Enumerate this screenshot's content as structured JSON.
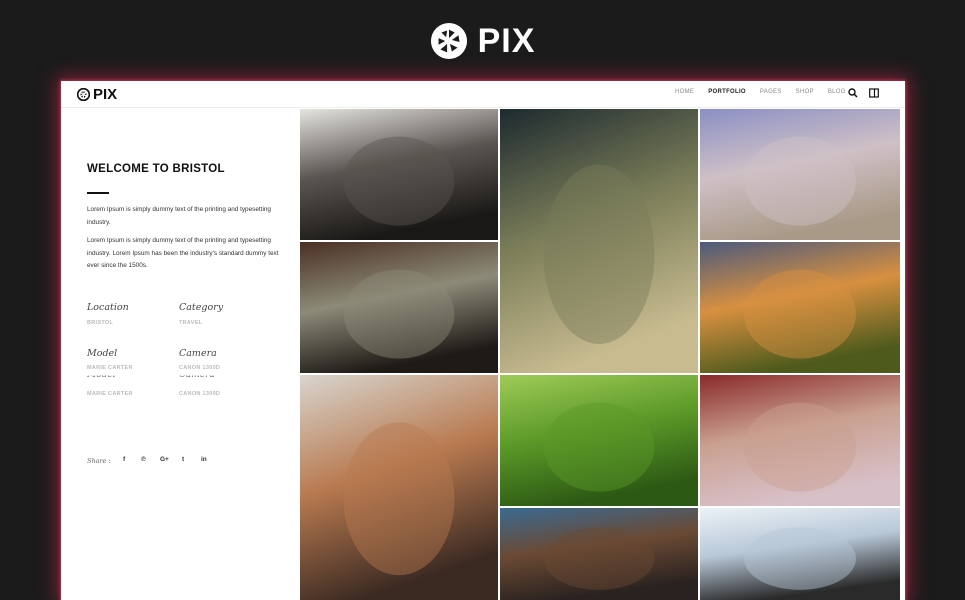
{
  "brand": {
    "name": "PIX",
    "icon": "aperture-icon"
  },
  "nav": {
    "logo": "PIX",
    "items": [
      {
        "label": "HOME",
        "active": false
      },
      {
        "label": "PORTFOLIO",
        "active": true
      },
      {
        "label": "PAGES",
        "active": false
      },
      {
        "label": "SHOP",
        "active": false
      },
      {
        "label": "BLOG",
        "active": false
      }
    ],
    "icons": [
      "search-icon",
      "sidebar-panel-icon"
    ]
  },
  "info": {
    "title": "WELCOME TO BRISTOL",
    "paragraph1": "Lorem Ipsum is simply dummy text of the printing and typesetting industry.",
    "paragraph2": "Lorem Ipsum is simply dummy text of the printing and typesetting industry. Lorem Ipsum has been the industry's standard dummy text ever since the 1500s.",
    "meta": [
      {
        "label": "Location",
        "value": "BRISTOL"
      },
      {
        "label": "Category",
        "value": "TRAVEL"
      },
      {
        "label": "Model",
        "value": "MARIE CARTER"
      },
      {
        "label": "Camera",
        "value": "CANON 1300D"
      }
    ],
    "meta_reflection": [
      {
        "label": "Model",
        "value": "MARIE CARTER"
      },
      {
        "label": "Camera",
        "value": "CANON 1300D"
      }
    ],
    "share": {
      "label": "Share :",
      "icons": [
        {
          "name": "facebook-icon",
          "glyph": "f"
        },
        {
          "name": "pinterest-icon",
          "glyph": "℗"
        },
        {
          "name": "google-plus-icon",
          "glyph": "G+"
        },
        {
          "name": "twitter-icon",
          "glyph": "t"
        },
        {
          "name": "linkedin-icon",
          "glyph": "in"
        }
      ]
    }
  },
  "gallery": [
    {
      "name": "photo-bw-two-women",
      "colors": [
        "#e6e4e0",
        "#5a5550",
        "#1a1816"
      ]
    },
    {
      "name": "photo-smoke-portrait",
      "colors": [
        "#1d2a2f",
        "#7a7d58",
        "#c8bb90"
      ]
    },
    {
      "name": "photo-beach-pose",
      "colors": [
        "#8a8fc4",
        "#cfc0c6",
        "#a99a88"
      ]
    },
    {
      "name": "photo-armchair",
      "colors": [
        "#4a3024",
        "#8c8a78",
        "#1e1a16"
      ]
    },
    {
      "name": "photo-sunset-landscape",
      "colors": [
        "#4c5a7c",
        "#d89040",
        "#4d5a1c"
      ]
    },
    {
      "name": "photo-blonde-portrait",
      "colors": [
        "#d9d5ce",
        "#b87a50",
        "#3b2a22"
      ]
    },
    {
      "name": "photo-grass-lying",
      "colors": [
        "#9fcb58",
        "#5c9a28",
        "#2c5a14"
      ]
    },
    {
      "name": "photo-red-backdrop",
      "colors": [
        "#8a2a2a",
        "#c9a090",
        "#d8c0c8"
      ]
    },
    {
      "name": "photo-rocky-shore",
      "colors": [
        "#3a6a90",
        "#6a4a34",
        "#2a2220"
      ]
    },
    {
      "name": "photo-plane-wreck",
      "colors": [
        "#ecf2f6",
        "#b8c8d8",
        "#2a2a2a"
      ]
    }
  ]
}
